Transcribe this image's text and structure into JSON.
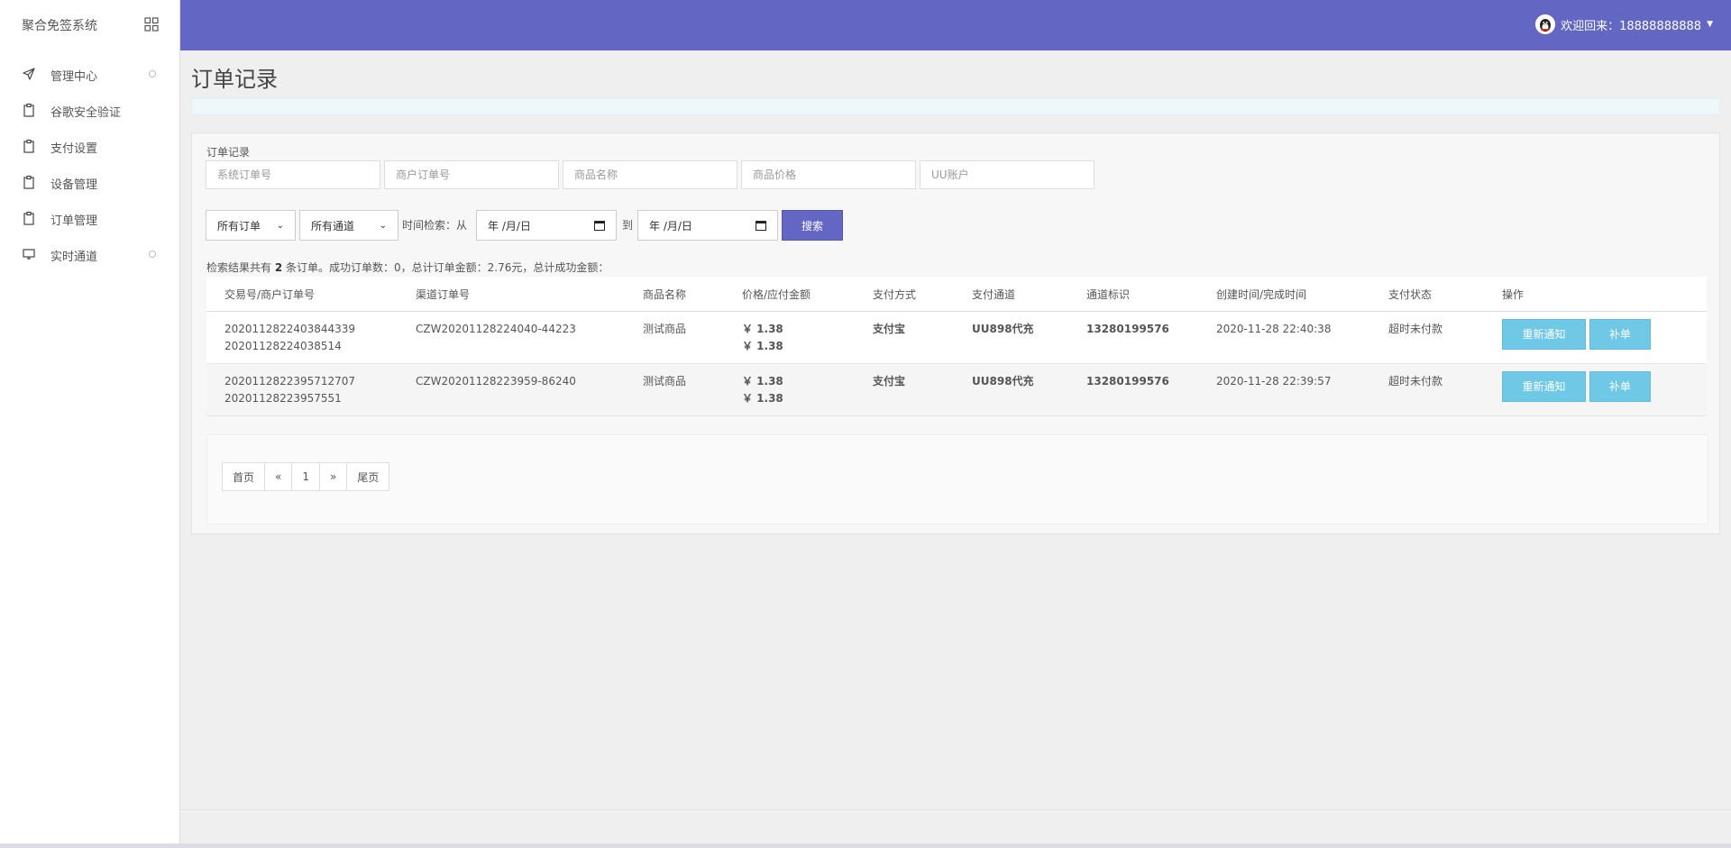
{
  "sidebar": {
    "brand": "聚合免签系统",
    "items": [
      {
        "label": "管理中心",
        "icon": "send-icon",
        "has_dot": true
      },
      {
        "label": "谷歌安全验证",
        "icon": "clipboard-icon",
        "has_dot": false
      },
      {
        "label": "支付设置",
        "icon": "clipboard-icon",
        "has_dot": false
      },
      {
        "label": "设备管理",
        "icon": "clipboard-icon",
        "has_dot": false
      },
      {
        "label": "订单管理",
        "icon": "clipboard-icon",
        "has_dot": false
      },
      {
        "label": "实时通道",
        "icon": "monitor-icon",
        "has_dot": true
      }
    ]
  },
  "header": {
    "greeting": "欢迎回来：18888888888",
    "accent": "#6366c3"
  },
  "page": {
    "title": "订单记录"
  },
  "filters": {
    "section_label": "订单记录",
    "placeholders": {
      "system_order": "系统订单号",
      "merchant_order": "商户订单号",
      "product_name": "商品名称",
      "product_price": "商品价格",
      "uu_account": "UU账户"
    },
    "order_select": "所有订单",
    "channel_select": "所有通道",
    "time_label": "时间检索：从",
    "date_from": "年 /月/日",
    "to_label": "到",
    "date_to": "年 /月/日",
    "search_button": "搜索"
  },
  "summary": {
    "prefix": "检索结果共有",
    "count": "2",
    "suffix": "条订单。成功订单数：0，总计订单金额：2.76元，总计成功金额："
  },
  "table": {
    "headers": [
      "交易号/商户订单号",
      "渠道订单号",
      "商品名称",
      "价格/应付金额",
      "支付方式",
      "支付通道",
      "通道标识",
      "创建时间/完成时间",
      "支付状态",
      "操作"
    ],
    "rows": [
      {
        "trade_no": "2020112822403844339",
        "merchant_no": "20201128224038514",
        "channel_order": "CZW20201128224040-44223",
        "product": "测试商品",
        "price": "￥ 1.38",
        "pay_amount": "￥ 1.38",
        "pay_method": "支付宝",
        "channel": "UU898代充",
        "channel_id": "13280199576",
        "created": "2020-11-28 22:40:38",
        "status": "超时未付款",
        "renotify": "重新通知",
        "reissue": "补单"
      },
      {
        "trade_no": "2020112822395712707",
        "merchant_no": "20201128223957551",
        "channel_order": "CZW20201128223959-86240",
        "product": "测试商品",
        "price": "￥ 1.38",
        "pay_amount": "￥ 1.38",
        "pay_method": "支付宝",
        "channel": "UU898代充",
        "channel_id": "13280199576",
        "created": "2020-11-28 22:39:57",
        "status": "超时未付款",
        "renotify": "重新通知",
        "reissue": "补单"
      }
    ]
  },
  "pagination": {
    "first": "首页",
    "prev": "«",
    "current": "1",
    "next": "»",
    "last": "尾页"
  }
}
